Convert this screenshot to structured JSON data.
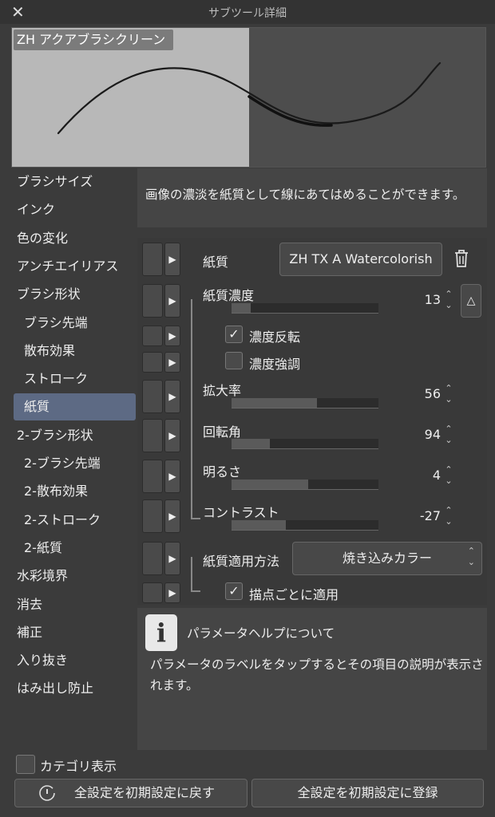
{
  "window": {
    "title": "サブツール詳細",
    "close_icon": "close-icon"
  },
  "preview": {
    "brush_name": "ZH アクアブラシクリーン"
  },
  "categories": [
    {
      "label": "ブラシサイズ",
      "indent": false
    },
    {
      "label": "インク",
      "indent": false
    },
    {
      "label": "色の変化",
      "indent": false
    },
    {
      "label": "アンチエイリアス",
      "indent": false
    },
    {
      "label": "ブラシ形状",
      "indent": false
    },
    {
      "label": "ブラシ先端",
      "indent": true
    },
    {
      "label": "散布効果",
      "indent": true
    },
    {
      "label": "ストローク",
      "indent": true
    },
    {
      "label": "紙質",
      "indent": true,
      "active": true
    },
    {
      "label": "2-ブラシ形状",
      "indent": false
    },
    {
      "label": "2-ブラシ先端",
      "indent": true
    },
    {
      "label": "2-散布効果",
      "indent": true
    },
    {
      "label": "2-ストローク",
      "indent": true
    },
    {
      "label": "2-紙質",
      "indent": true
    },
    {
      "label": "水彩境界",
      "indent": false
    },
    {
      "label": "消去",
      "indent": false
    },
    {
      "label": "補正",
      "indent": false
    },
    {
      "label": "入り抜き",
      "indent": false
    },
    {
      "label": "はみ出し防止",
      "indent": false
    }
  ],
  "description": "画像の濃淡を紙質として線にあてはめることができます。",
  "params": {
    "texture": {
      "label": "紙質",
      "value": "ZH TX A Watercolorish"
    },
    "density": {
      "label": "紙質濃度",
      "value": "13",
      "fill": 0.13
    },
    "invert": {
      "label": "濃度反転",
      "checked": true
    },
    "emphasize": {
      "label": "濃度強調",
      "checked": false
    },
    "scale": {
      "label": "拡大率",
      "value": "56",
      "fill": 0.58
    },
    "rotation": {
      "label": "回転角",
      "value": "94",
      "fill": 0.26
    },
    "brightness": {
      "label": "明るさ",
      "value": "4",
      "fill": 0.52
    },
    "contrast": {
      "label": "コントラスト",
      "value": "-27",
      "fill": 0.37
    },
    "apply_method": {
      "label": "紙質適用方法",
      "value": "焼き込みカラー"
    },
    "per_dab": {
      "label": "描点ごとに適用",
      "checked": true
    }
  },
  "help": {
    "title": "パラメータヘルプについて",
    "body": "パラメータのラベルをタップするとその項目の説明が表示されます。"
  },
  "footer": {
    "show_category_label": "カテゴリ表示",
    "show_category_checked": false,
    "reset_label": "全設定を初期設定に戻す",
    "register_label": "全設定を初期設定に登録"
  }
}
